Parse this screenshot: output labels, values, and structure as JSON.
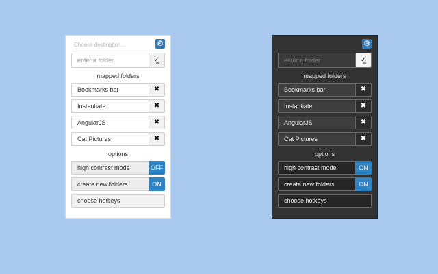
{
  "light": {
    "title": "Choose destination...",
    "folder_placeholder": "enter a folder",
    "mapped_heading": "mapped folders",
    "folders": [
      "Bookmarks bar",
      "Instantiate",
      "AngularJS",
      "Cat Pictures"
    ],
    "options_heading": "options",
    "options": [
      {
        "label": "high contrast mode",
        "state": "OFF"
      },
      {
        "label": "create new folders",
        "state": "ON"
      }
    ],
    "hotkeys_label": "choose hotkeys"
  },
  "dark": {
    "folder_placeholder": "enter a folder",
    "mapped_heading": "mapped folders",
    "folders": [
      "Bookmarks bar",
      "Instantiate",
      "AngularJS",
      "Cat Pictures"
    ],
    "options_heading": "options",
    "options": [
      {
        "label": "high contrast mode",
        "state": "ON"
      },
      {
        "label": "create new folders",
        "state": "ON"
      }
    ],
    "hotkeys_label": "choose hotkeys"
  },
  "icons": {
    "settings": "gear-icon",
    "save": "checkmark-icon",
    "remove": "close-icon"
  },
  "colors": {
    "accent": "#2d82c4",
    "background": "#a9c9ee"
  }
}
